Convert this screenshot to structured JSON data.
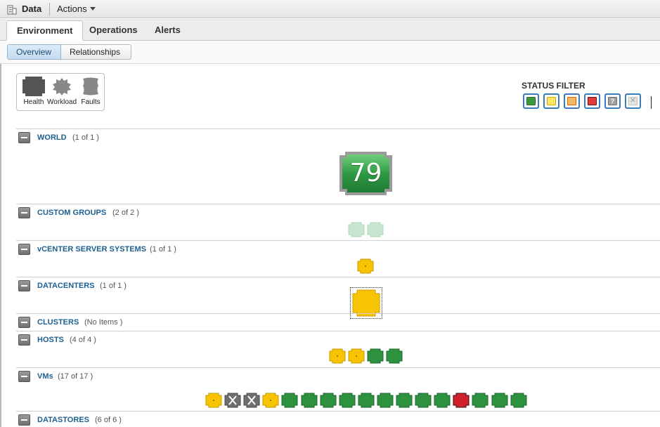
{
  "toolbar": {
    "title": "Data",
    "actions_label": "Actions"
  },
  "tabs": [
    {
      "label": "Environment",
      "active": true
    },
    {
      "label": "Operations",
      "active": false
    },
    {
      "label": "Alerts",
      "active": false
    }
  ],
  "subtabs": [
    {
      "label": "Overview",
      "active": true
    },
    {
      "label": "Relationships",
      "active": false
    }
  ],
  "badges": [
    {
      "label": "Health",
      "icon": "health-icon"
    },
    {
      "label": "Workload",
      "icon": "workload-icon"
    },
    {
      "label": "Faults",
      "icon": "faults-icon"
    }
  ],
  "status_filter": {
    "title": "STATUS FILTER",
    "items": [
      {
        "status": "green",
        "color": "#3c9a3c"
      },
      {
        "status": "yellow",
        "color": "#f7d32e"
      },
      {
        "status": "orange",
        "color": "#f5993a"
      },
      {
        "status": "red",
        "color": "#d92b2b"
      },
      {
        "status": "unknown",
        "color": "#9a9a9a"
      },
      {
        "status": "none",
        "color": "#e0e0e0"
      }
    ]
  },
  "sections": [
    {
      "label": "WORLD",
      "count": "(1 of 1 )"
    },
    {
      "label": "CUSTOM GROUPS",
      "count": "(2 of 2 )"
    },
    {
      "label": "vCENTER SERVER SYSTEMS",
      "count": "(1 of 1 )"
    },
    {
      "label": "DATACENTERS",
      "count": "(1 of 1 )"
    },
    {
      "label": "CLUSTERS",
      "count": "(No Items )"
    },
    {
      "label": "HOSTS",
      "count": "(4 of 4 )"
    },
    {
      "label": "VMs",
      "count": "(17 of 17 )"
    },
    {
      "label": "DATASTORES",
      "count": "(6 of 6 )"
    }
  ],
  "world_health": "79",
  "colors": {
    "green": "#2e9140",
    "yellow": "#f8c300",
    "red": "#d0202a",
    "grey": "#6e6e6e",
    "pale_green": "#c8e6cf",
    "link": "#1d5f8f"
  },
  "objects": {
    "custom_groups": [
      "pale_green",
      "pale_green"
    ],
    "vcenter": [
      "yellow"
    ],
    "datacenters": [
      "yellow"
    ],
    "hosts": [
      "yellow",
      "yellow",
      "green",
      "green"
    ],
    "vms": [
      "yellow",
      "grey-x",
      "grey-x",
      "yellow",
      "green",
      "green",
      "green",
      "green",
      "green",
      "green",
      "green",
      "green",
      "green",
      "red",
      "green",
      "green",
      "green"
    ]
  }
}
